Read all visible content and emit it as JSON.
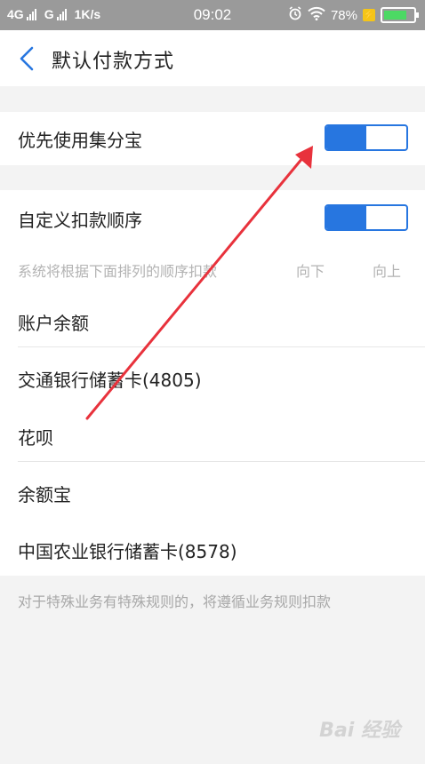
{
  "status_bar": {
    "network_1": "4G",
    "network_2": "G",
    "speed": "1K/s",
    "time": "09:02",
    "battery": "78%",
    "battery_level": 0.78,
    "icons": [
      "signal-icon",
      "alarm-icon",
      "wifi-icon",
      "charging-icon",
      "battery-icon"
    ]
  },
  "header": {
    "title": "默认付款方式",
    "back_icon": "chevron-left-icon"
  },
  "section1": {
    "label": "优先使用集分宝",
    "toggle_on": true
  },
  "section2": {
    "label": "自定义扣款顺序",
    "toggle_on": true,
    "hint": "系统将根据下面排列的顺序扣款",
    "down_label": "向下",
    "up_label": "向上",
    "items": [
      {
        "label": "账户余额"
      },
      {
        "label": "交通银行储蓄卡(4805)"
      },
      {
        "label": "花呗"
      },
      {
        "label": "余额宝"
      },
      {
        "label": "中国农业银行储蓄卡(8578)"
      }
    ]
  },
  "footer_note": "对于特殊业务有特殊规则的，将遵循业务规则扣款",
  "watermark": "Bai 经验",
  "colors": {
    "accent": "#2776e0",
    "annotation_arrow": "#e8323c",
    "status_bar": "#9a9a9a",
    "battery_fill": "#4cd964"
  }
}
